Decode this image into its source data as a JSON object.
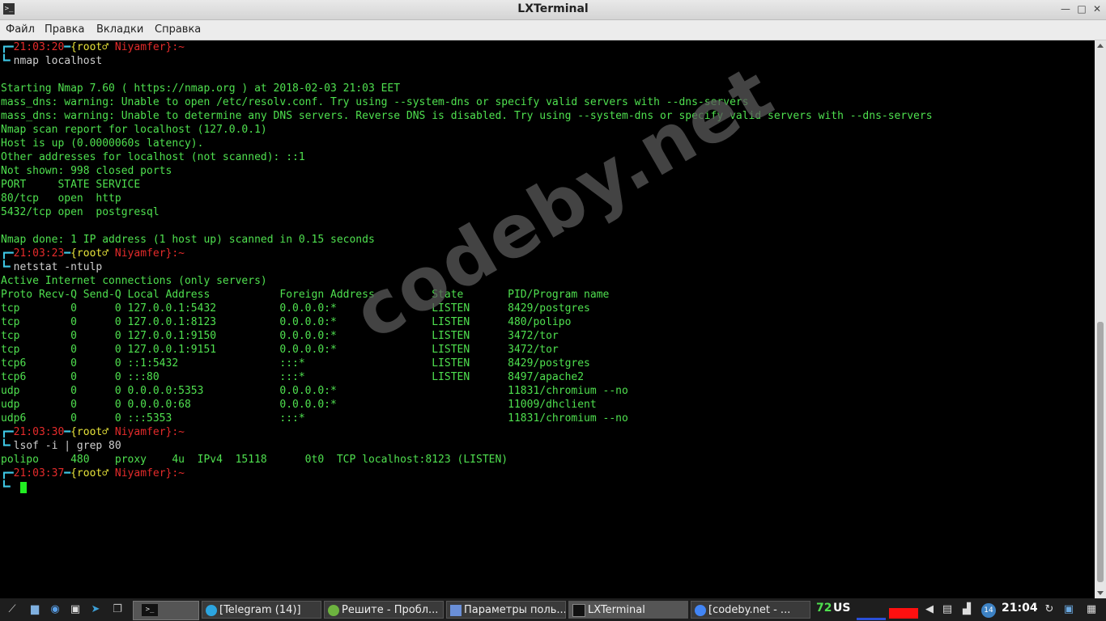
{
  "window": {
    "title": "LXTerminal",
    "app_icon": ">_",
    "minimize": "—",
    "maximize": "□",
    "close": "✕"
  },
  "menu": [
    "Файл",
    "Правка",
    "Вкладки",
    "Справка"
  ],
  "prompts": [
    {
      "time": "21:03:20",
      "user": "{root♂",
      "host": "Niyamfer}:~",
      "command": "nmap localhost"
    },
    {
      "time": "21:03:23",
      "user": "{root♂",
      "host": "Niyamfer}:~",
      "command": "netstat -ntulp"
    },
    {
      "time": "21:03:30",
      "user": "{root♂",
      "host": "Niyamfer}:~",
      "command": "lsof -i | grep 80"
    },
    {
      "time": "21:03:37",
      "user": "{root♂",
      "host": "Niyamfer}:~",
      "command": ""
    }
  ],
  "nmap_output": [
    "",
    "Starting Nmap 7.60 ( https://nmap.org ) at 2018-02-03 21:03 EET",
    "mass_dns: warning: Unable to open /etc/resolv.conf. Try using --system-dns or specify valid servers with --dns-servers",
    "mass_dns: warning: Unable to determine any DNS servers. Reverse DNS is disabled. Try using --system-dns or specify valid servers with --dns-servers",
    "Nmap scan report for localhost (127.0.0.1)",
    "Host is up (0.0000060s latency).",
    "Other addresses for localhost (not scanned): ::1",
    "Not shown: 998 closed ports",
    "PORT     STATE SERVICE",
    "80/tcp   open  http",
    "5432/tcp open  postgresql",
    "",
    "Nmap done: 1 IP address (1 host up) scanned in 0.15 seconds"
  ],
  "netstat_output": [
    "Active Internet connections (only servers)",
    "Proto Recv-Q Send-Q Local Address           Foreign Address         State       PID/Program name",
    "tcp        0      0 127.0.0.1:5432          0.0.0.0:*               LISTEN      8429/postgres",
    "tcp        0      0 127.0.0.1:8123          0.0.0.0:*               LISTEN      480/polipo",
    "tcp        0      0 127.0.0.1:9150          0.0.0.0:*               LISTEN      3472/tor",
    "tcp        0      0 127.0.0.1:9151          0.0.0.0:*               LISTEN      3472/tor",
    "tcp6       0      0 ::1:5432                :::*                    LISTEN      8429/postgres",
    "tcp6       0      0 :::80                   :::*                    LISTEN      8497/apache2",
    "udp        0      0 0.0.0.0:5353            0.0.0.0:*                           11831/chromium --no",
    "udp        0      0 0.0.0.0:68              0.0.0.0:*                           11009/dhclient",
    "udp6       0      0 :::5353                 :::*                                11831/chromium --no"
  ],
  "lsof_output": [
    "polipo     480    proxy    4u  IPv4  15118      0t0  TCP localhost:8123 (LISTEN)"
  ],
  "watermark": "codeby.net",
  "taskbar": {
    "tasks": [
      {
        "label": "[Telegram (14)]",
        "icon": "telegram-icon"
      },
      {
        "label": "Решите - Пробл...",
        "icon": "browser-icon"
      },
      {
        "label": "Параметры поль...",
        "icon": "user-settings-icon"
      },
      {
        "label": "LXTerminal",
        "icon": "terminal-icon"
      },
      {
        "label": "[codeby.net - ...",
        "icon": "chromium-icon"
      }
    ],
    "battery_percent": "72",
    "keyboard_layout": "US",
    "notification_count": "14",
    "clock": "21:04"
  },
  "colors": {
    "terminal_fg": "#4fe04f",
    "prompt_time": "#e52b2b",
    "prompt_user": "#e8e43a",
    "prompt_bracket": "#3ec8e6",
    "taskbar_bg": "#1e1e1e"
  }
}
